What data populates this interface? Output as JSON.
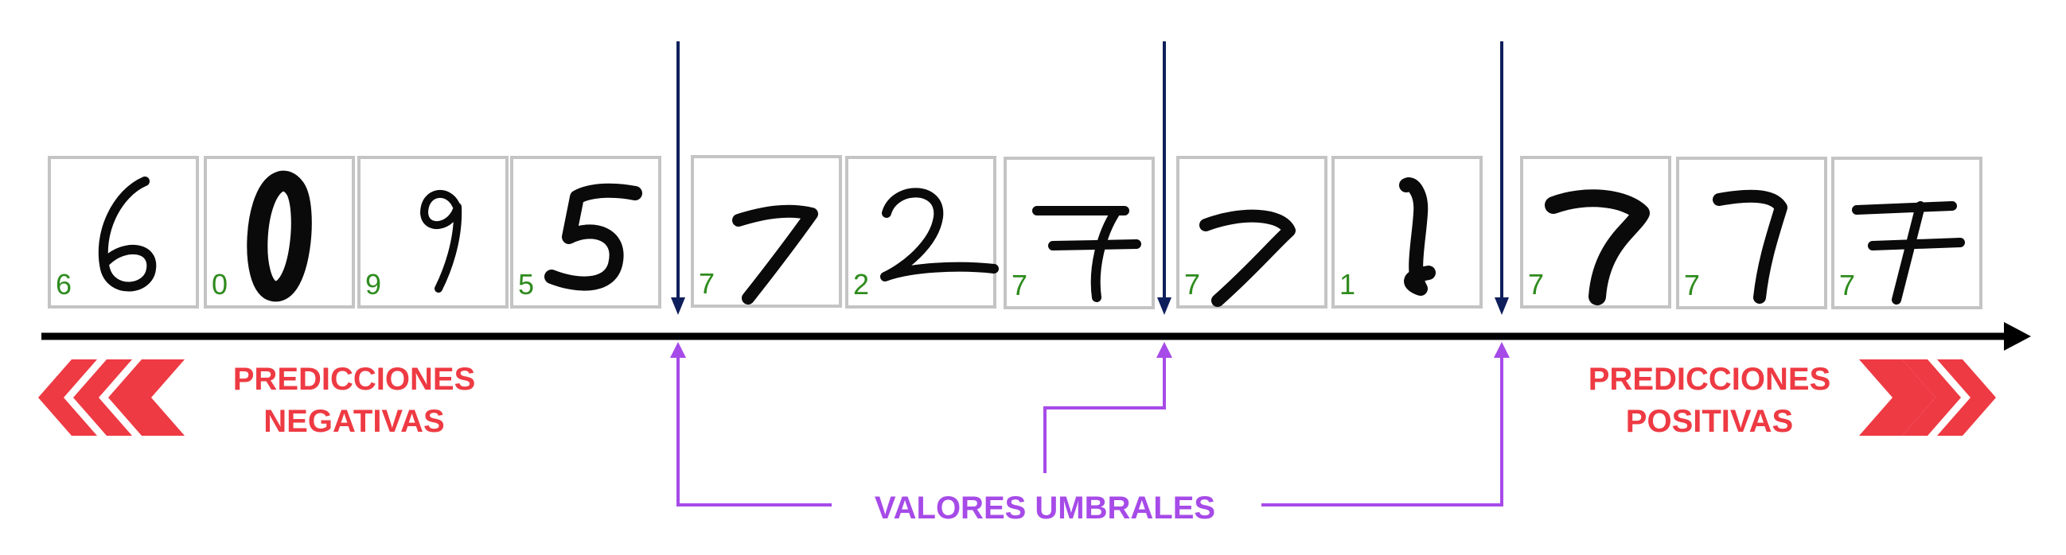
{
  "axis": {
    "color": "#000000",
    "direction": "left-to-right"
  },
  "samples": [
    {
      "digit": "6",
      "label": "6"
    },
    {
      "digit": "0",
      "label": "0"
    },
    {
      "digit": "9",
      "label": "9"
    },
    {
      "digit": "5",
      "label": "5"
    },
    {
      "digit": "7",
      "label": "7"
    },
    {
      "digit": "2",
      "label": "2"
    },
    {
      "digit": "7",
      "label": "7"
    },
    {
      "digit": "7",
      "label": "7"
    },
    {
      "digit": "1",
      "label": "1"
    },
    {
      "digit": "7",
      "label": "7"
    },
    {
      "digit": "7",
      "label": "7"
    },
    {
      "digit": "7",
      "label": "7"
    }
  ],
  "thresholds": {
    "count": 3,
    "marker_color": "#0f1f5c",
    "bracket_color": "#a64ae8",
    "caption": "VALORES UMBRALES"
  },
  "negative_side": {
    "line1": "PREDICCIONES",
    "line2": "NEGATIVAS",
    "chevron_icon": "chevrons-left-icon",
    "color": "#ee3a43"
  },
  "positive_side": {
    "line1": "PREDICCIONES",
    "line2": "POSITIVAS",
    "chevron_icon": "chevrons-right-icon",
    "color": "#ee3a43"
  },
  "colors": {
    "label_green": "#2e8b1e",
    "frame_gray": "#c4c4c4",
    "digit_ink": "#0a0a0a"
  }
}
